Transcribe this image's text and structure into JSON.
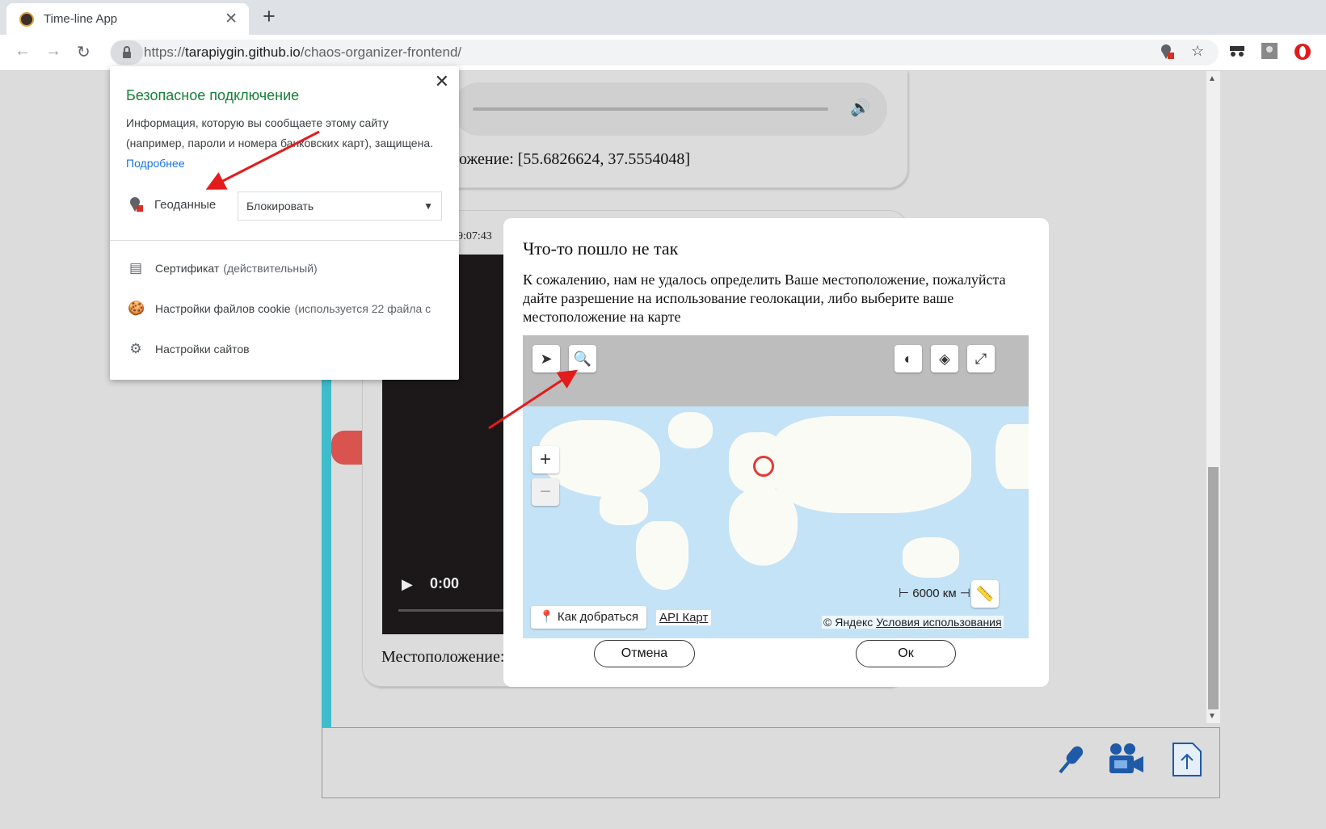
{
  "browser": {
    "tab_title": "Time-line App",
    "url_scheme": "https://",
    "url_host": "tarapiygin.github.io",
    "url_path": "/chaos-organizer-frontend/"
  },
  "popup": {
    "title": "Безопасное подключение",
    "text": "Информация, которую вы сообщаете этому сайту (например, пароли и номера банковских карт), защищена.",
    "more_link": "Подробнее",
    "geo_label": "Геоданные",
    "geo_value": "Блокировать",
    "rows": [
      {
        "label": "Сертификат",
        "muted": "(действительный)"
      },
      {
        "label": "Настройки файлов cookie",
        "muted": "(используется 22 файла с"
      },
      {
        "label": "Настройки сайтов",
        "muted": ""
      }
    ]
  },
  "timeline": {
    "location_1": "ложение: [55.6826624, 37.5554048]",
    "time_2": "9:07:43",
    "video_time": "0:00",
    "location_2": "Местоположение:"
  },
  "modal": {
    "title": "Что-то пошло не так",
    "text": "К сожалению, нам не удалось определить Ваше местоположение, пожалуйста дайте разрешение на использование геолокации, либо выберите ваше местоположение на карте",
    "cancel_label": "Отмена",
    "ok_label": "Ок",
    "map": {
      "scale_label": "6000 км",
      "route_label": "Как добраться",
      "api_label": "API Карт",
      "copyright": "© Яндекс",
      "terms_label": "Условия использования"
    }
  },
  "colors": {
    "accent_red": "#d9534f",
    "track_teal": "#3fbccc",
    "secure_green": "#188038",
    "map_water": "#c5e3f6",
    "icon_blue": "#1e5aa8"
  }
}
